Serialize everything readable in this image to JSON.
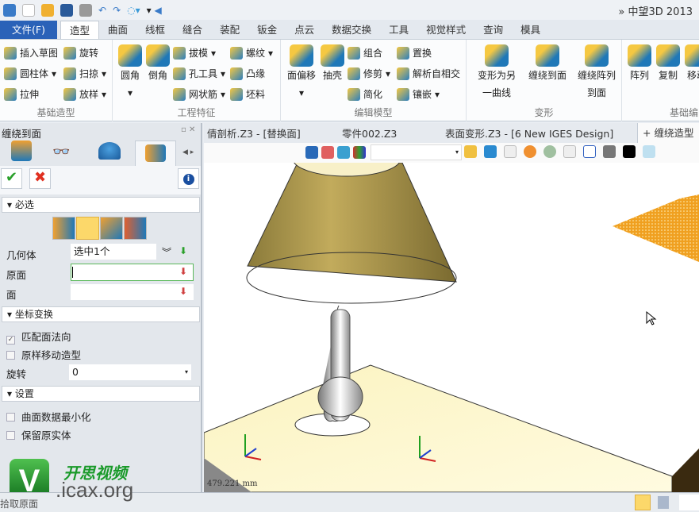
{
  "app": {
    "title": "中望3D 2013"
  },
  "menu": {
    "file": "文件(F)",
    "tabs": [
      "造型",
      "曲面",
      "线框",
      "缝合",
      "装配",
      "钣金",
      "点云",
      "数据交换",
      "工具",
      "视觉样式",
      "查询",
      "模具"
    ]
  },
  "ribbon": {
    "basic": {
      "label": "基础造型",
      "items": [
        "插入草图",
        "旋转",
        "圆柱体",
        "扫掠",
        "拉伸",
        "放样"
      ]
    },
    "eng": {
      "label": "工程特征",
      "big": [
        "圆角",
        "倒角"
      ],
      "items": [
        "拔模",
        "螺纹",
        "孔工具",
        "凸缘",
        "网状筋",
        "坯料"
      ]
    },
    "edit": {
      "label": "编辑模型",
      "big": [
        "面偏移",
        "抽壳"
      ],
      "items": [
        "组合",
        "置换",
        "修剪",
        "解析自相交",
        "简化",
        "镶嵌"
      ]
    },
    "deform": {
      "label": "变形",
      "big": [
        "变形为另一曲线",
        "缠绕到面",
        "缠绕阵列到面"
      ]
    },
    "basic2": {
      "label": "基础编",
      "big": [
        "阵列",
        "复制",
        "移动"
      ]
    }
  },
  "panel": {
    "title": "缠绕到面",
    "required": {
      "label": "必选",
      "geometry_label": "几何体",
      "geometry_value": "选中1个",
      "source_label": "原面",
      "source_value": "",
      "face_label": "面",
      "face_value": ""
    },
    "transform": {
      "label": "坐标变换",
      "match_normal": "匹配面法向",
      "match_normal_checked": true,
      "move_copy": "原样移动造型",
      "move_copy_checked": false,
      "rotate_label": "旋转",
      "rotate_value": "0"
    },
    "settings": {
      "label": "设置",
      "minimize": "曲面数据最小化",
      "minimize_checked": false,
      "keep": "保留原实体",
      "keep_checked": false
    }
  },
  "doctabs": [
    "倩剖析.Z3 - [替换面]",
    "零件002.Z3",
    "表面变形.Z3 - [6 New IGES Design]",
    "缠绕造型"
  ],
  "viewport": {
    "scale": "479.221 mm"
  },
  "watermark": {
    "cn": "开思视频",
    "url": ".icax.org"
  },
  "status": {
    "prompt": "拾取原面"
  }
}
